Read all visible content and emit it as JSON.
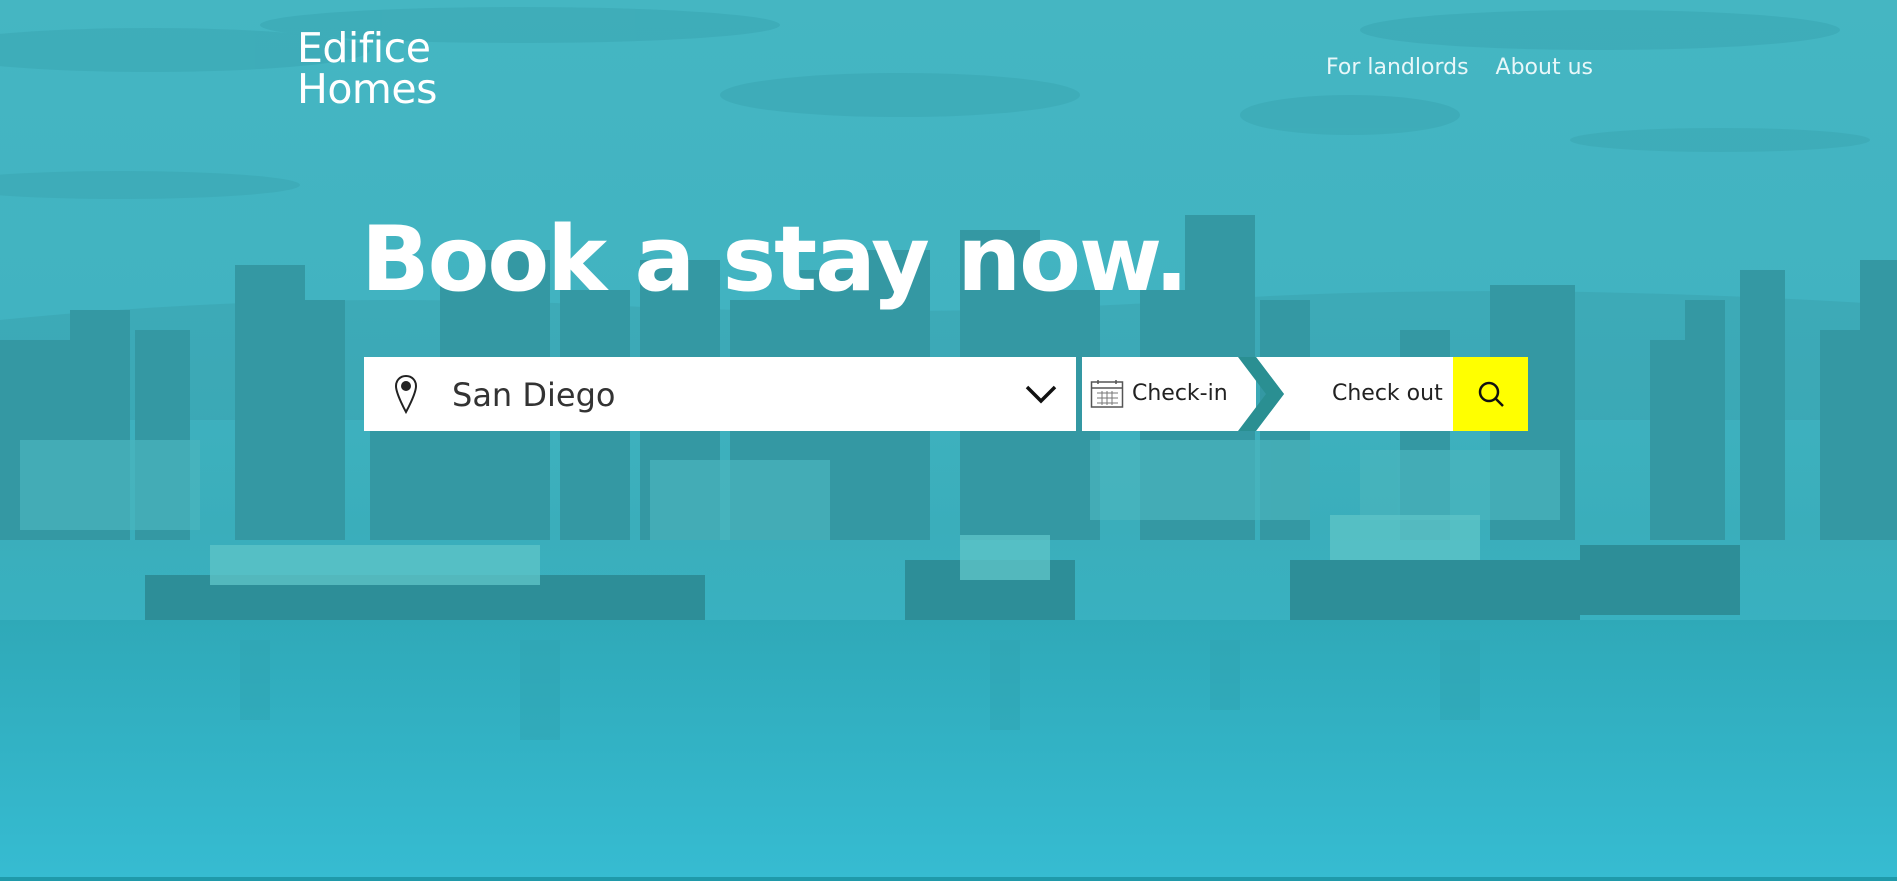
{
  "brand": {
    "line1": "Edifice",
    "line2": "Homes"
  },
  "nav": {
    "landlords": "For landlords",
    "about": "About us"
  },
  "hero": {
    "headline": "Book a stay now."
  },
  "search": {
    "location_value": "San Diego",
    "location_icon": "map-pin-icon",
    "dropdown_icon": "chevron-down-icon",
    "checkin_label": "Check-in",
    "checkin_icon": "calendar-icon",
    "checkout_label": "Check out",
    "search_icon": "search-icon"
  },
  "colors": {
    "overlay": "#3cb3c0",
    "accent_button": "#ffff00",
    "separator": "#2a8f92",
    "text_white": "#ffffff"
  }
}
